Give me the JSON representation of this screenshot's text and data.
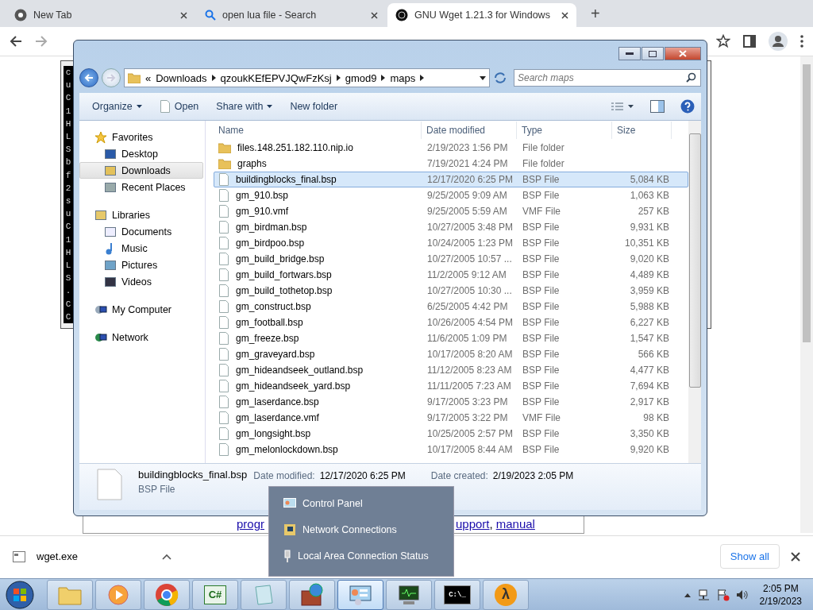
{
  "browser": {
    "tabs": [
      {
        "title": "New Tab",
        "kind": "chrome",
        "selected": false
      },
      {
        "title": "open lua file - Search",
        "kind": "search",
        "selected": false
      },
      {
        "title": "GNU Wget 1.21.3 for Windows",
        "kind": "site",
        "selected": true
      }
    ],
    "new_tab": "+"
  },
  "background_window": {
    "console_lines": [
      "c",
      "u",
      "C",
      "1",
      "H",
      "L",
      "S",
      "b",
      "f",
      "2",
      "s",
      "u",
      "C",
      "1",
      "H",
      "L",
      "S",
      ".",
      "C",
      "C"
    ]
  },
  "page_row": {
    "links": [
      {
        "text": "progr"
      },
      {
        "text": "upport"
      },
      {
        "text": "manual"
      }
    ],
    "separator": ","
  },
  "download_bar": {
    "file": "wget.exe",
    "show_all": "Show all"
  },
  "explorer": {
    "path": [
      "Downloads",
      "qzoukKEfEPVJQwFzKsj",
      "gmod9",
      "maps"
    ],
    "path_prefix": "«",
    "search": {
      "placeholder": "Search maps"
    },
    "toolbar": [
      {
        "label": "Organize",
        "kind": "menu"
      },
      {
        "label": "Open",
        "kind": "open"
      },
      {
        "label": "Share with",
        "kind": "menu"
      },
      {
        "label": "New folder",
        "kind": "plain"
      }
    ],
    "nav": [
      {
        "label": "Favorites",
        "kind": "favorites",
        "selected": false,
        "children": [
          {
            "label": "Desktop",
            "kind": "desktop",
            "selected": false
          },
          {
            "label": "Downloads",
            "kind": "downloads",
            "selected": true
          },
          {
            "label": "Recent Places",
            "kind": "recent",
            "selected": false
          }
        ]
      },
      {
        "label": "Libraries",
        "kind": "libraries",
        "selected": false,
        "children": [
          {
            "label": "Documents",
            "kind": "documents",
            "selected": false
          },
          {
            "label": "Music",
            "kind": "music",
            "selected": false
          },
          {
            "label": "Pictures",
            "kind": "pictures",
            "selected": false
          },
          {
            "label": "Videos",
            "kind": "videos",
            "selected": false
          }
        ]
      },
      {
        "label": "My Computer",
        "kind": "computer",
        "selected": false
      },
      {
        "label": "Network",
        "kind": "network",
        "selected": false
      }
    ],
    "columns": [
      "Name",
      "Date modified",
      "Type",
      "Size"
    ],
    "rows": [
      {
        "name": "files.148.251.182.110.nip.io",
        "date": "2/19/2023 1:56 PM",
        "type": "File folder",
        "kind": "folder",
        "selected": false
      },
      {
        "name": "graphs",
        "date": "7/19/2021 4:24 PM",
        "type": "File folder",
        "kind": "folder",
        "selected": false
      },
      {
        "name": "buildingblocks_final.bsp",
        "date": "12/17/2020 6:25 PM",
        "type": "BSP File",
        "size": "5,084 KB",
        "kind": "file",
        "selected": true
      },
      {
        "name": "gm_910.bsp",
        "date": "9/25/2005 9:09 AM",
        "type": "BSP File",
        "size": "1,063 KB",
        "kind": "file",
        "selected": false
      },
      {
        "name": "gm_910.vmf",
        "date": "9/25/2005 5:59 AM",
        "type": "VMF File",
        "size": "257 KB",
        "kind": "file",
        "selected": false
      },
      {
        "name": "gm_birdman.bsp",
        "date": "10/27/2005 3:48 PM",
        "type": "BSP File",
        "size": "9,931 KB",
        "kind": "file",
        "selected": false
      },
      {
        "name": "gm_birdpoo.bsp",
        "date": "10/24/2005 1:23 PM",
        "type": "BSP File",
        "size": "10,351 KB",
        "kind": "file",
        "selected": false
      },
      {
        "name": "gm_build_bridge.bsp",
        "date": "10/27/2005 10:57 ...",
        "type": "BSP File",
        "size": "9,020 KB",
        "kind": "file",
        "selected": false
      },
      {
        "name": "gm_build_fortwars.bsp",
        "date": "11/2/2005 9:12 AM",
        "type": "BSP File",
        "size": "4,489 KB",
        "kind": "file",
        "selected": false
      },
      {
        "name": "gm_build_tothetop.bsp",
        "date": "10/27/2005 10:30 ...",
        "type": "BSP File",
        "size": "3,959 KB",
        "kind": "file",
        "selected": false
      },
      {
        "name": "gm_construct.bsp",
        "date": "6/25/2005 4:42 PM",
        "type": "BSP File",
        "size": "5,988 KB",
        "kind": "file",
        "selected": false
      },
      {
        "name": "gm_football.bsp",
        "date": "10/26/2005 4:54 PM",
        "type": "BSP File",
        "size": "6,227 KB",
        "kind": "file",
        "selected": false
      },
      {
        "name": "gm_freeze.bsp",
        "date": "11/6/2005 1:09 PM",
        "type": "BSP File",
        "size": "1,547 KB",
        "kind": "file",
        "selected": false
      },
      {
        "name": "gm_graveyard.bsp",
        "date": "10/17/2005 8:20 AM",
        "type": "BSP File",
        "size": "566 KB",
        "kind": "file",
        "selected": false
      },
      {
        "name": "gm_hideandseek_outland.bsp",
        "date": "11/12/2005 8:23 AM",
        "type": "BSP File",
        "size": "4,477 KB",
        "kind": "file",
        "selected": false
      },
      {
        "name": "gm_hideandseek_yard.bsp",
        "date": "11/11/2005 7:23 AM",
        "type": "BSP File",
        "size": "7,694 KB",
        "kind": "file",
        "selected": false
      },
      {
        "name": "gm_laserdance.bsp",
        "date": "9/17/2005 3:23 PM",
        "type": "BSP File",
        "size": "2,917 KB",
        "kind": "file",
        "selected": false
      },
      {
        "name": "gm_laserdance.vmf",
        "date": "9/17/2005 3:22 PM",
        "type": "VMF File",
        "size": "98 KB",
        "kind": "file",
        "selected": false
      },
      {
        "name": "gm_longsight.bsp",
        "date": "10/25/2005 2:57 PM",
        "type": "BSP File",
        "size": "3,350 KB",
        "kind": "file",
        "selected": false
      },
      {
        "name": "gm_melonlockdown.bsp",
        "date": "10/17/2005 8:44 AM",
        "type": "BSP File",
        "size": "9,920 KB",
        "kind": "file",
        "selected": false
      }
    ],
    "details": {
      "name": "buildingblocks_final.bsp",
      "type": "BSP File",
      "modified_label": "Date modified:",
      "modified": "12/17/2020 6:25 PM",
      "created_label": "Date created:",
      "created": "2/19/2023 2:05 PM"
    }
  },
  "jump_list": [
    {
      "label": "Control Panel",
      "kind": "panel"
    },
    {
      "label": "Network Connections",
      "kind": "connections"
    },
    {
      "label": "Local Area Connection Status",
      "kind": "status"
    }
  ],
  "taskbar": {
    "items": [
      {
        "kind": "folder",
        "selected": false
      },
      {
        "kind": "media",
        "selected": false
      },
      {
        "kind": "browser",
        "selected": false
      },
      {
        "kind": "code",
        "glyph": "C#",
        "selected": false
      },
      {
        "kind": "notepad",
        "selected": false
      },
      {
        "kind": "firewall",
        "selected": false
      },
      {
        "kind": "panel",
        "selected": true
      },
      {
        "kind": "monitor",
        "selected": false
      },
      {
        "kind": "console",
        "glyph": "C:\\_",
        "selected": false
      },
      {
        "kind": "game",
        "glyph": "λ",
        "selected": false
      }
    ],
    "time": "2:05 PM",
    "date": "2/19/2023"
  }
}
